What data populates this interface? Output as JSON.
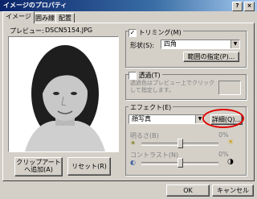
{
  "window": {
    "title": "イメージのプロパティ",
    "help_label": "?",
    "close_label": "×"
  },
  "tabs": [
    {
      "label": "イメージ"
    },
    {
      "label": "囲み線"
    },
    {
      "label": "配置"
    }
  ],
  "preview": {
    "label": "プレビュー:",
    "filename": "DSCN5154.JPG"
  },
  "trimming": {
    "label": "トリミング(M)",
    "checked": true,
    "shape_label": "形状(S):",
    "shape_value": "四角",
    "range_button": "範囲の指定(P)..."
  },
  "transparent": {
    "label": "透過(T)",
    "checked": false,
    "description": "透過色はプレビュー上でクリックして指定します。"
  },
  "effect": {
    "label": "エフェクト(E)",
    "value": "顔写真",
    "detail_button": "詳細(Q)...",
    "highlight_color": "#e00000"
  },
  "brightness": {
    "label": "明るさ(B)",
    "value_label": "0%",
    "level": 0.5
  },
  "contrast": {
    "label": "コントラスト(N)",
    "value_label": "0%",
    "level": 0.5
  },
  "actions": {
    "clipart_line1": "クリップアート",
    "clipart_line2": "へ追加(A)",
    "reset_label": "リセット(R)",
    "ok_label": "OK",
    "cancel_label": "キャンセル"
  }
}
